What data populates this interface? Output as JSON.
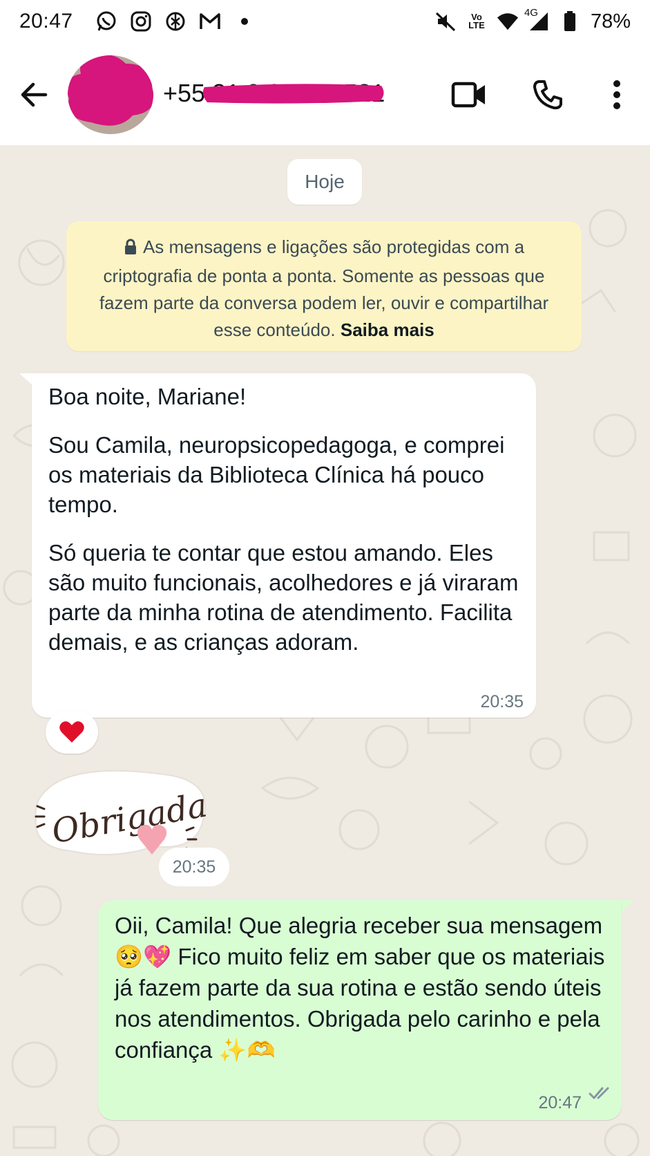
{
  "status_bar": {
    "time": "20:47",
    "notification_icons": [
      "whatsapp-icon",
      "instagram-icon",
      "threads-icon",
      "gmail-icon",
      "dot-icon"
    ],
    "network_label": "Vo LTE",
    "network_type": "4G",
    "battery": "78%"
  },
  "header": {
    "contact_name": "+55 31 9 8700 4521",
    "back_icon": "arrow-back-icon",
    "actions": [
      "video-call-icon",
      "voice-call-icon",
      "more-vert-icon"
    ]
  },
  "chat": {
    "date_chip": "Hoje",
    "encryption_notice": {
      "text": "As mensagens e ligações são protegidas com a criptografia de ponta a ponta. Somente as pessoas que fazem parte da conversa podem ler, ouvir e compartilhar esse conteúdo.",
      "link": "Saiba mais"
    },
    "messages": [
      {
        "direction": "incoming",
        "paragraphs": [
          "Boa noite, Mariane!",
          "Sou Camila, neuropsicopedagoga, e comprei os materiais da Biblioteca Clínica há pouco tempo.",
          "Só queria te contar que estou amando. Eles são muito funcionais, acolhedores e já viraram parte da minha rotina de atendimento. Facilita demais, e as crianças adoram."
        ],
        "time": "20:35",
        "reaction": "❤️"
      },
      {
        "direction": "incoming",
        "sticker_text": "Obrigada",
        "time": "20:35"
      },
      {
        "direction": "outgoing",
        "text": "Oii, Camila! Que alegria receber sua mensagem 🥺💖 Fico muito feliz em saber que os materiais já fazem parte da sua rotina e estão sendo úteis nos atendimentos. Obrigada pelo carinho e pela confiança ✨🫶",
        "time": "20:47",
        "status": "read"
      }
    ]
  },
  "colors": {
    "chat_background": "#efeae2",
    "incoming_bubble": "#ffffff",
    "outgoing_bubble": "#d9fdd3",
    "encryption_bg": "#fdf4c5",
    "redaction": "#d6157d",
    "read_check": "#8696a0"
  }
}
